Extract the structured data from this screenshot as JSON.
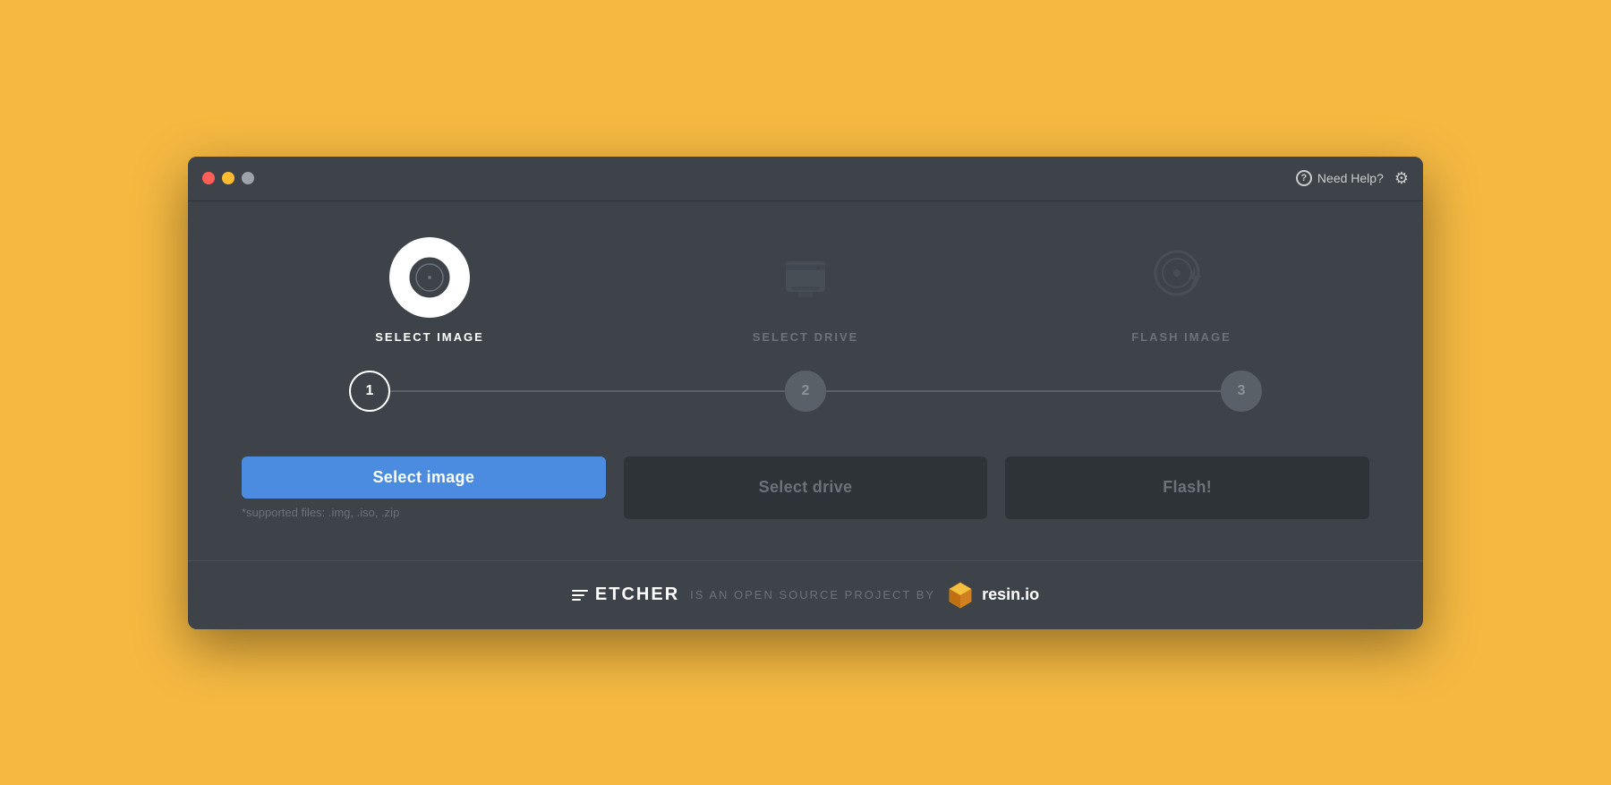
{
  "window": {
    "buttons": {
      "close": "close",
      "minimize": "minimize",
      "maximize": "maximize"
    }
  },
  "header": {
    "help_label": "Need Help?",
    "help_icon": "?",
    "gear_icon": "⚙"
  },
  "steps": [
    {
      "id": 1,
      "label": "SELECT IMAGE",
      "state": "active",
      "number": "1"
    },
    {
      "id": 2,
      "label": "SELECT DRIVE",
      "state": "inactive",
      "number": "2"
    },
    {
      "id": 3,
      "label": "FLASH IMAGE",
      "state": "inactive",
      "number": "3"
    }
  ],
  "buttons": {
    "select_image": "Select image",
    "select_drive": "Select drive",
    "flash": "Flash!"
  },
  "supported_files": "*supported files: .img, .iso, .zip",
  "footer": {
    "etcher_name": "ETCHER",
    "separator": "IS AN OPEN SOURCE PROJECT BY",
    "resin_name": "resin.io"
  }
}
